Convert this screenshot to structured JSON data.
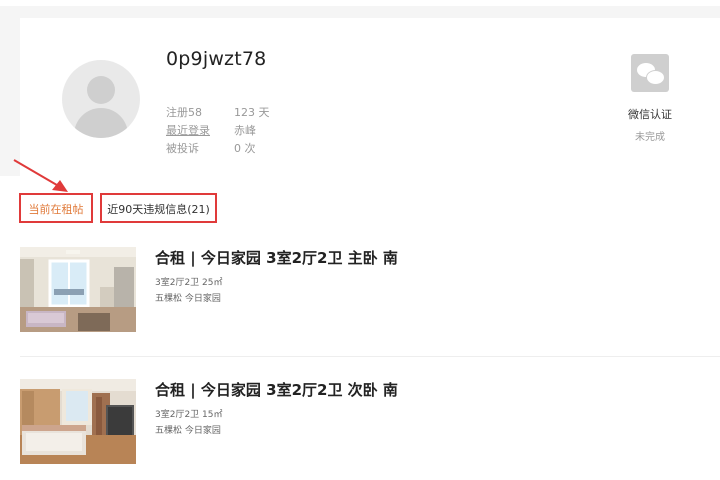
{
  "profile": {
    "username": "0p9jwzt78",
    "stats": [
      {
        "label": "注册58",
        "value": "123 天"
      },
      {
        "label": "最近登录",
        "value": "赤峰"
      },
      {
        "label": "被投诉",
        "value": "0 次"
      }
    ],
    "wechat": {
      "icon": "wechat-icon",
      "title": "微信认证",
      "status": "未完成"
    }
  },
  "tabs": [
    {
      "label": "当前在租帖",
      "active": true
    },
    {
      "label": "近90天违规信息(21)",
      "active": false
    }
  ],
  "colors": {
    "highlight_border": "#e03a3a",
    "active_tab_text": "#e07a3a"
  },
  "listings": [
    {
      "title": "合租 | 今日家园 3室2厅2卫 主卧 南",
      "layout_area": "3室2厅2卫 25㎡",
      "location": "五棵松 今日家园"
    },
    {
      "title": "合租 | 今日家园 3室2厅2卫 次卧 南",
      "layout_area": "3室2厅2卫 15㎡",
      "location": "五棵松 今日家园"
    }
  ]
}
